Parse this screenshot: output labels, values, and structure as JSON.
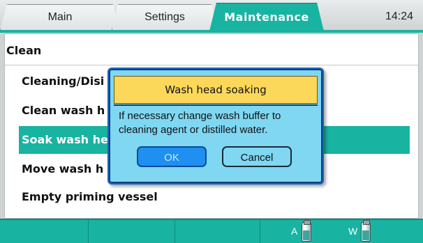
{
  "tabs": {
    "main": "Main",
    "settings": "Settings",
    "maintenance": "Maintenance",
    "active": "Maintenance"
  },
  "clock": "14:24",
  "panel": {
    "title": "Clean",
    "items": [
      {
        "label": "Cleaning/Disinfection",
        "shown": "Cleaning/Disi"
      },
      {
        "label": "Clean wash head",
        "shown": "Clean wash h"
      },
      {
        "label": "Soak wash head",
        "shown": "Soak wash he",
        "selected": true
      },
      {
        "label": "Move wash head",
        "shown": "Move wash h"
      },
      {
        "label": "Empty priming vessel",
        "shown": "Empty priming vessel"
      }
    ]
  },
  "dialog": {
    "title": "Wash head soaking",
    "message_line1": "If necessary change wash buffer to",
    "message_line2": "cleaning agent or distilled water.",
    "ok_label": "OK",
    "cancel_label": "Cancel"
  },
  "bottom_bar": {
    "bottle_a_label": "A",
    "bottle_w_label": "W"
  },
  "colors": {
    "accent": "#19b3a2",
    "dialog_bg": "#7fd7f2",
    "dialog_title_bg": "#fbd85a",
    "ok_button": "#1f8ff2"
  },
  "icons": {
    "bottle_a": "bottle-icon",
    "bottle_w": "bottle-icon"
  }
}
